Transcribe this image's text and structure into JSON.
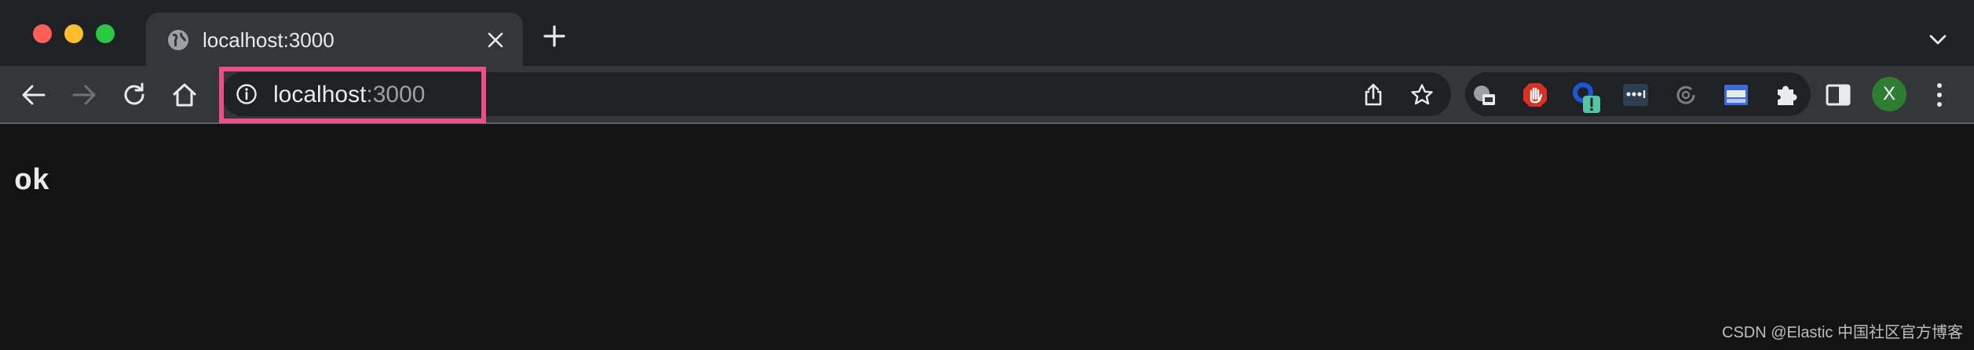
{
  "tab": {
    "title": "localhost:3000"
  },
  "address_bar": {
    "host": "localhost",
    "port": ":3000"
  },
  "profile": {
    "initial": "X"
  },
  "page": {
    "content": "ok"
  },
  "watermark": "CSDN @Elastic 中国社区官方博客",
  "icons": {
    "tab_favicon": "globe-icon",
    "tab_close": "close-icon",
    "new_tab": "plus-icon",
    "tab_search": "chevron-down-icon",
    "back": "arrow-left-icon",
    "forward": "arrow-right-icon",
    "reload": "reload-icon",
    "home": "home-icon",
    "site_info": "info-icon",
    "share": "share-icon",
    "bookmark": "star-icon",
    "extensions": "puzzle-icon",
    "side_panel": "side-panel-icon",
    "menu": "kebab-menu-icon"
  },
  "colors": {
    "tab_strip": "#202124",
    "toolbar": "#35363a",
    "page_background": "#131313",
    "highlight": "#ec4f86"
  }
}
